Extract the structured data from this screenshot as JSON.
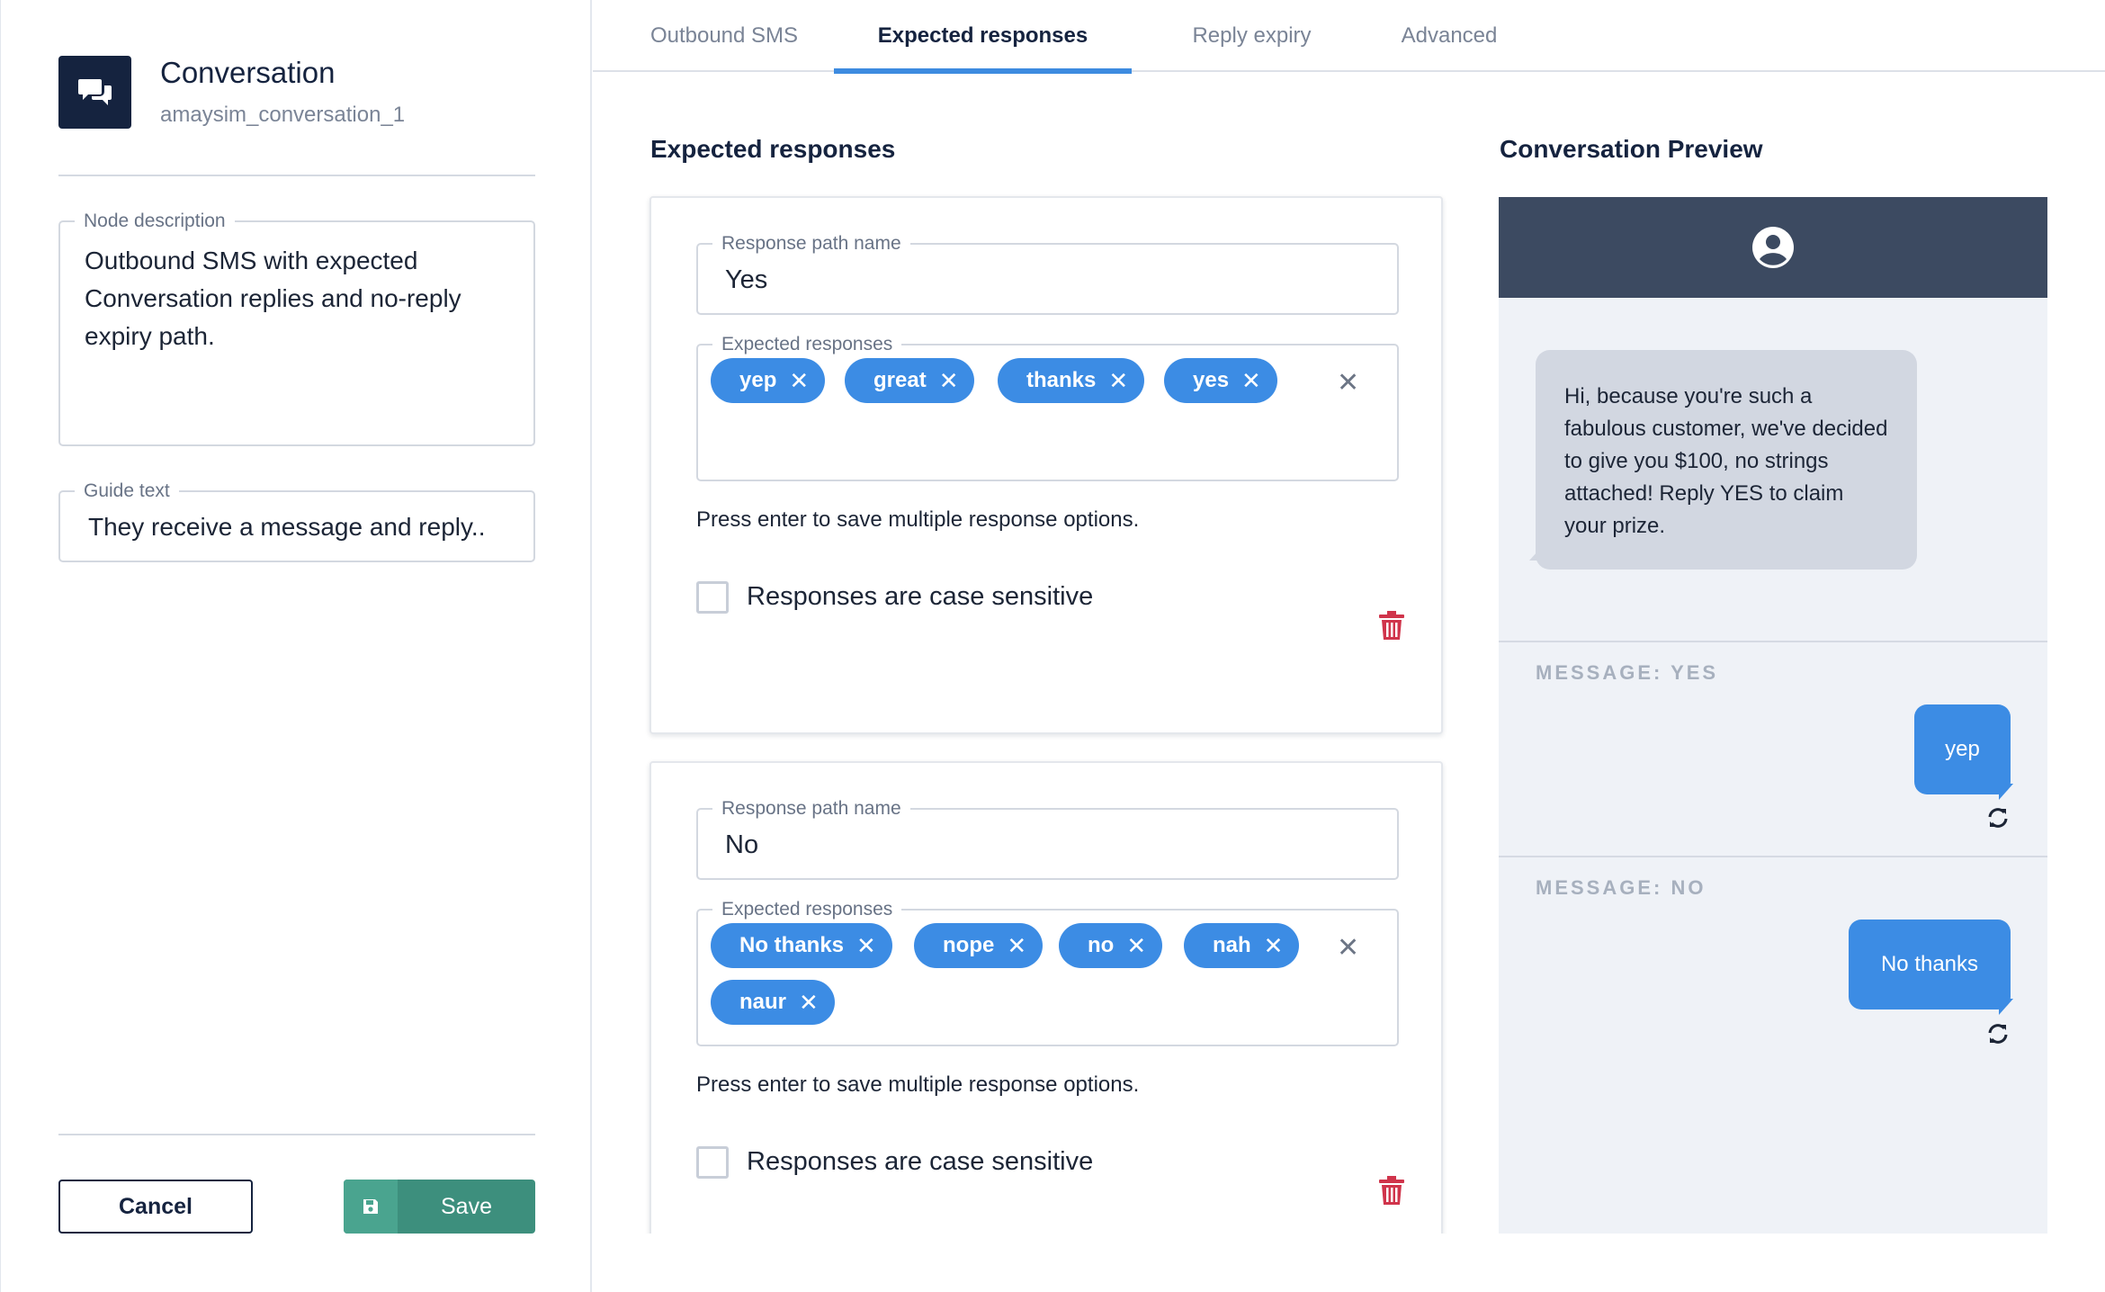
{
  "node": {
    "title": "Conversation",
    "id": "amaysim_conversation_1",
    "icon": "chat-bubbles-icon"
  },
  "description": {
    "legend": "Node description",
    "value": "Outbound SMS with expected Conversation replies and no-reply expiry path."
  },
  "guide": {
    "legend": "Guide text",
    "value": "They receive a message and reply.."
  },
  "actions": {
    "cancel_label": "Cancel",
    "save_label": "Save"
  },
  "tabs": [
    {
      "label": "Outbound SMS",
      "active": false
    },
    {
      "label": "Expected responses",
      "active": true
    },
    {
      "label": "Reply expiry",
      "active": false
    },
    {
      "label": "Advanced",
      "active": false
    }
  ],
  "main": {
    "title": "Expected responses"
  },
  "paths": [
    {
      "name_legend": "Response path name",
      "name": "Yes",
      "responses_legend": "Expected responses",
      "responses": [
        "yep",
        "great",
        "thanks",
        "yes"
      ],
      "helper": "Press enter to save multiple response options.",
      "case_label": "Responses are case sensitive",
      "case_sensitive": false
    },
    {
      "name_legend": "Response path name",
      "name": "No",
      "responses_legend": "Expected responses",
      "responses": [
        "No thanks",
        "nope",
        "no",
        "nah",
        "naur"
      ],
      "helper": "Press enter to save multiple response options.",
      "case_label": "Responses are case sensitive",
      "case_sensitive": false
    }
  ],
  "preview": {
    "title": "Conversation Preview",
    "outbound_message": "Hi, because you're such a fabulous customer, we've decided to give you $100, no strings attached! Reply YES to claim your prize.",
    "replies": [
      {
        "label": "MESSAGE: YES",
        "text": "yep"
      },
      {
        "label": "MESSAGE: NO",
        "text": "No thanks"
      }
    ]
  },
  "colors": {
    "navy": "#15233f",
    "accent_blue": "#3c8ce4",
    "save_green": "#3d8f7d",
    "danger_red": "#d0344b",
    "preview_header": "#3c4a61"
  }
}
